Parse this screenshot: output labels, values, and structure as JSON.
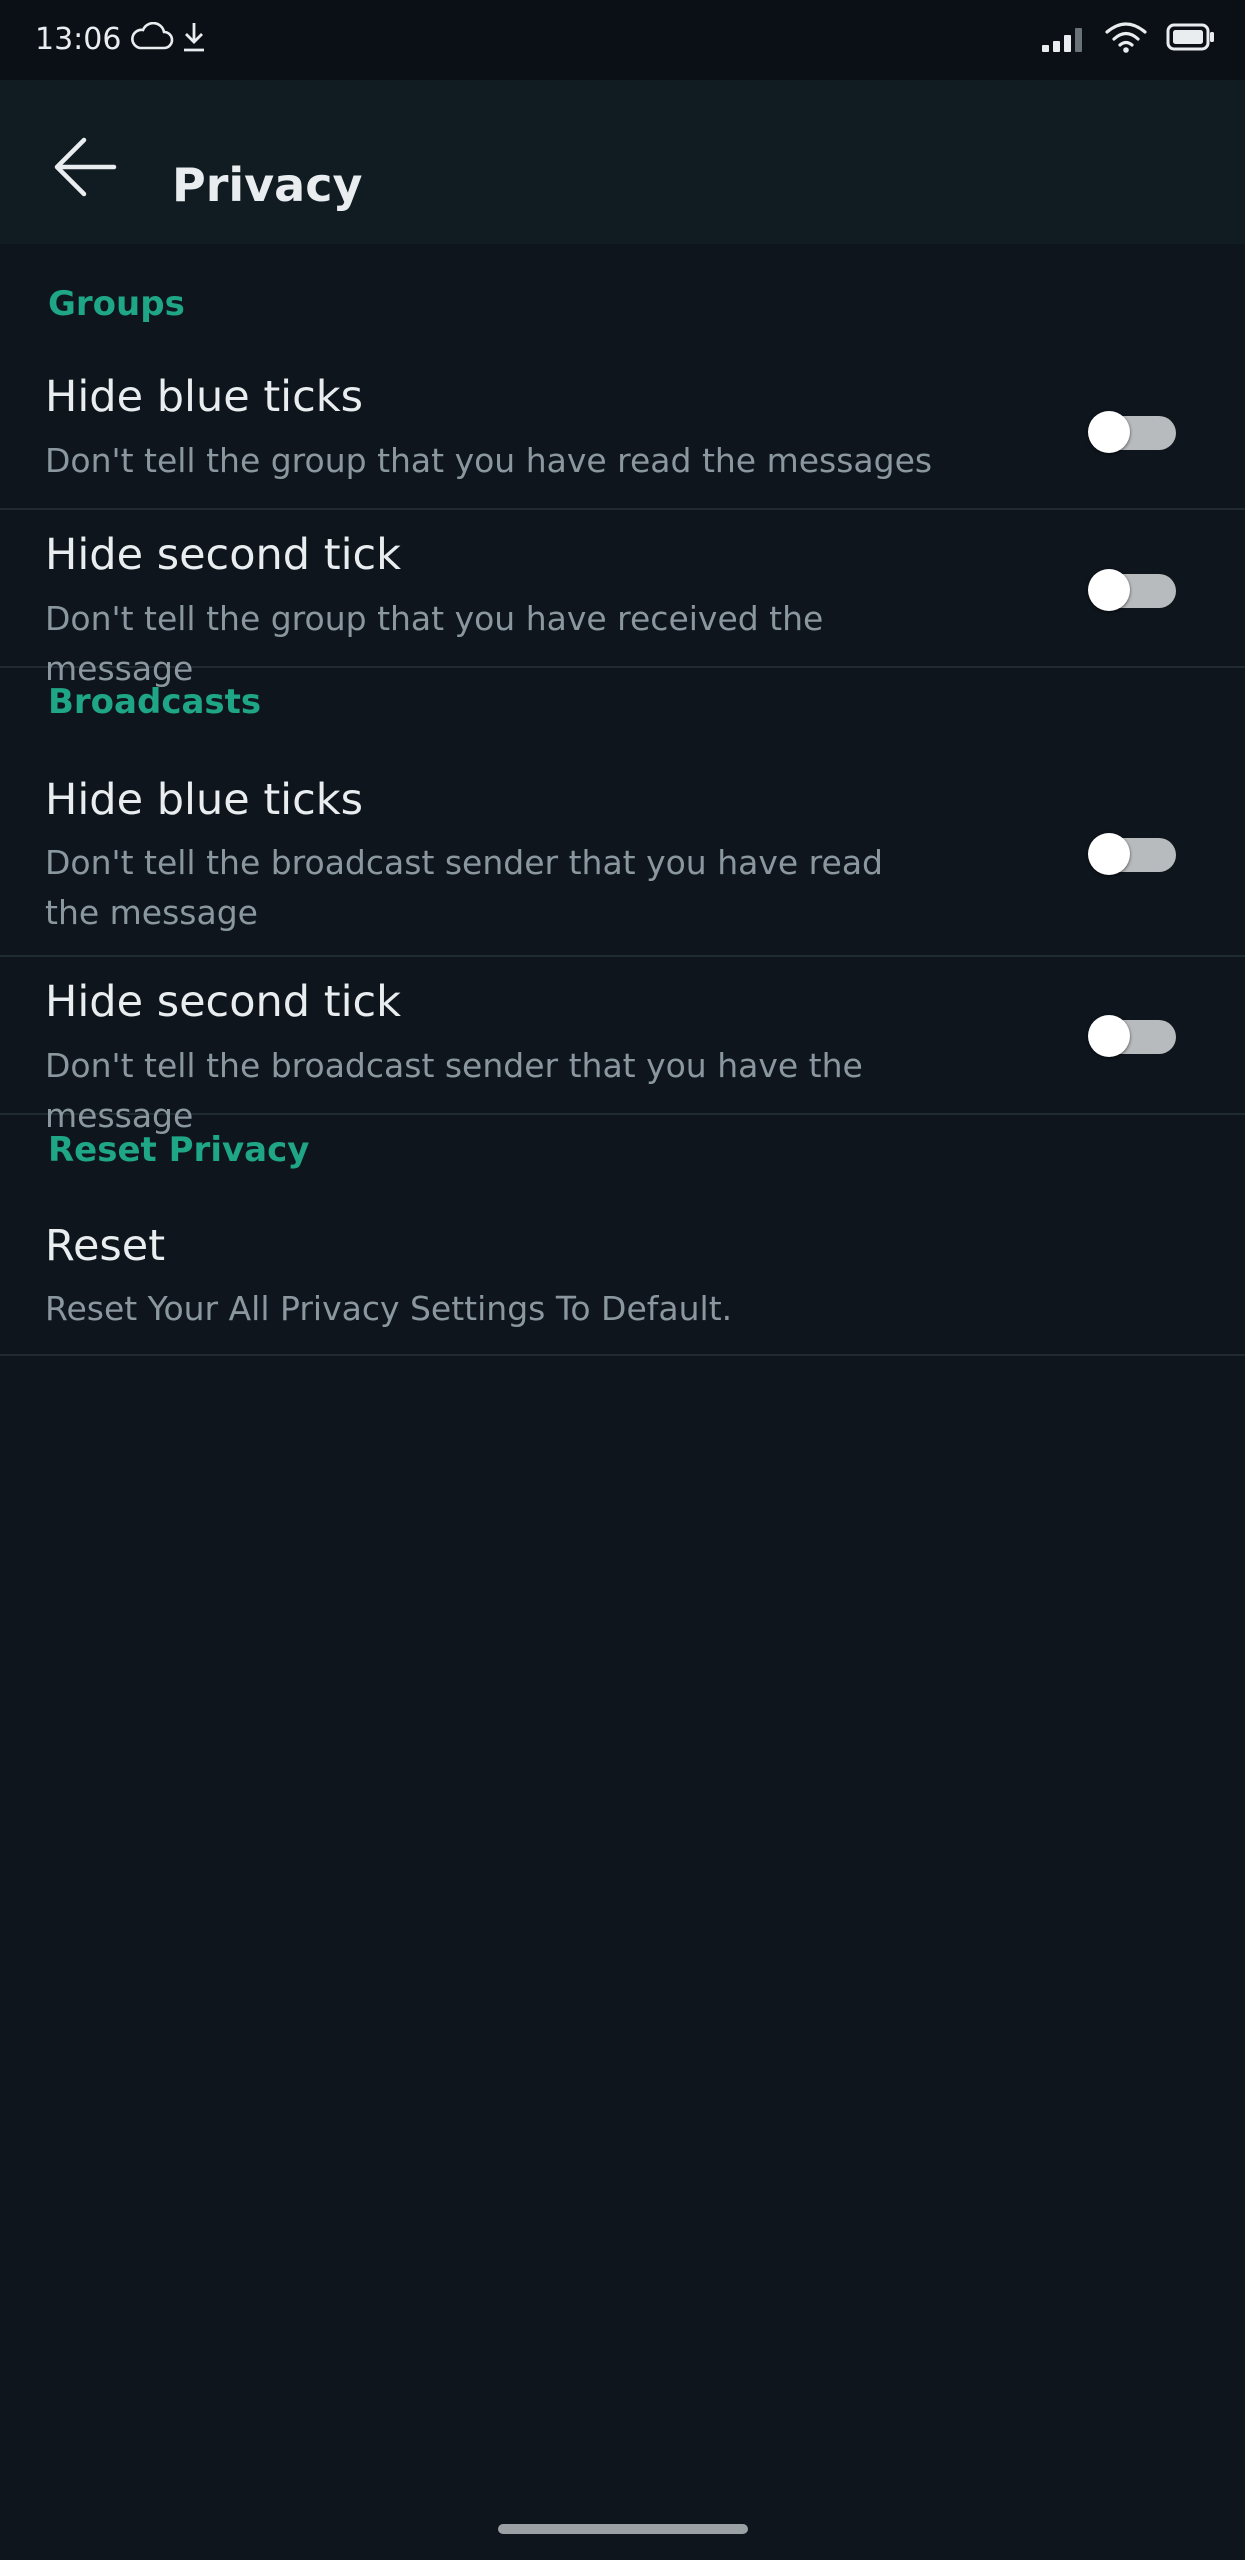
{
  "status_bar": {
    "time": "13:06",
    "left_icons": [
      "cloud-icon",
      "download-icon"
    ],
    "right_icons": [
      "signal-icon",
      "wifi-icon",
      "battery-icon"
    ]
  },
  "app_bar": {
    "back_icon": "arrow-left-icon",
    "title": "Privacy"
  },
  "sections": [
    {
      "header": "Groups",
      "items": [
        {
          "title": "Hide blue ticks",
          "subtitle": "Don't tell the group that you have read the messages",
          "toggle_on": false
        },
        {
          "title": "Hide second tick",
          "subtitle": "Don't tell the group that you have received the message",
          "toggle_on": false
        }
      ]
    },
    {
      "header": "Broadcasts",
      "items": [
        {
          "title": "Hide blue ticks",
          "subtitle": "Don't tell the broadcast sender that you have read the message",
          "toggle_on": false
        },
        {
          "title": "Hide second tick",
          "subtitle": "Don't tell the broadcast sender that you have the message",
          "toggle_on": false
        }
      ]
    },
    {
      "header": "Reset Privacy",
      "items": [
        {
          "title": "Reset",
          "subtitle": "Reset Your All Privacy Settings To Default."
        }
      ]
    }
  ],
  "colors": {
    "background": "#0e151d",
    "app_bar": "#111b22",
    "accent": "#1fa686",
    "primary_text": "#e9edef",
    "secondary_text": "#8b979e",
    "divider": "#1f2a31",
    "toggle_track_off": "#b8bbbe",
    "toggle_thumb": "#ffffff"
  }
}
